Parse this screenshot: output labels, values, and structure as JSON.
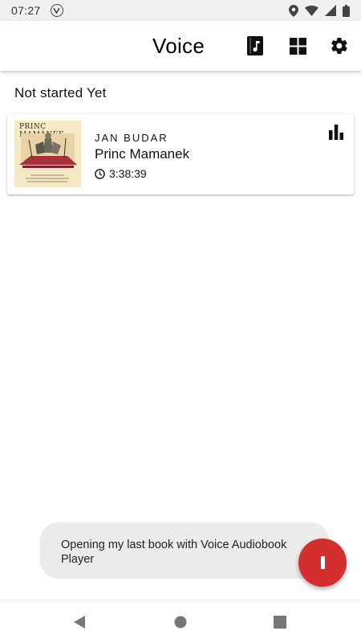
{
  "status_bar": {
    "time": "07:27",
    "icons": [
      "voice-logo-icon",
      "location-icon",
      "wifi-icon",
      "signal-icon",
      "battery-icon"
    ]
  },
  "toolbar": {
    "title": "Voice",
    "actions": [
      "add-book-icon",
      "grid-view-icon",
      "settings-icon"
    ]
  },
  "section": {
    "header": "Not started Yet"
  },
  "books": [
    {
      "author": "JAN BUDAR",
      "title": "Princ Mamanek",
      "duration": "3:38:39",
      "cover_text": "PRINC MAMÁNEK",
      "currently_playing_icon": "equalizer-icon"
    }
  ],
  "snackbar": {
    "message": "Opening my last book with Voice Audiobook Player"
  },
  "fab": {
    "icon": "pause-icon",
    "color": "#d32f2f"
  },
  "nav": {
    "items": [
      "back-icon",
      "home-icon",
      "recents-icon"
    ]
  }
}
